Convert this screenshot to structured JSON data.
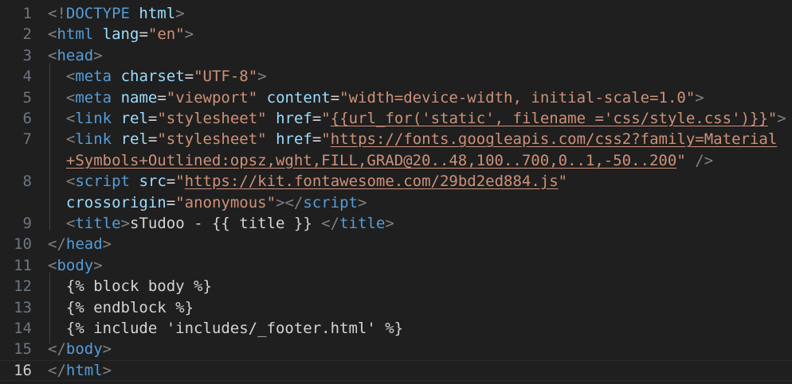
{
  "editor": {
    "language": "html",
    "active_line": 16,
    "lines": [
      {
        "num": "1",
        "tokens": [
          [
            "p",
            "<!"
          ],
          [
            "t",
            "DOCTYPE"
          ],
          [
            "d",
            " "
          ],
          [
            "a",
            "html"
          ],
          [
            "p",
            ">"
          ]
        ]
      },
      {
        "num": "2",
        "tokens": [
          [
            "p",
            "<"
          ],
          [
            "t",
            "html"
          ],
          [
            "d",
            " "
          ],
          [
            "a",
            "lang"
          ],
          [
            "d",
            "="
          ],
          [
            "s",
            "\"en\""
          ],
          [
            "p",
            ">"
          ]
        ]
      },
      {
        "num": "3",
        "tokens": [
          [
            "p",
            "<"
          ],
          [
            "t",
            "head"
          ],
          [
            "p",
            ">"
          ]
        ]
      },
      {
        "num": "4",
        "tokens": [
          [
            "d",
            "  "
          ],
          [
            "p",
            "<"
          ],
          [
            "t",
            "meta"
          ],
          [
            "d",
            " "
          ],
          [
            "a",
            "charset"
          ],
          [
            "d",
            "="
          ],
          [
            "s",
            "\"UTF-8\""
          ],
          [
            "p",
            ">"
          ]
        ]
      },
      {
        "num": "5",
        "tokens": [
          [
            "d",
            "  "
          ],
          [
            "p",
            "<"
          ],
          [
            "t",
            "meta"
          ],
          [
            "d",
            " "
          ],
          [
            "a",
            "name"
          ],
          [
            "d",
            "="
          ],
          [
            "s",
            "\"viewport\""
          ],
          [
            "d",
            " "
          ],
          [
            "a",
            "content"
          ],
          [
            "d",
            "="
          ],
          [
            "s",
            "\"width=device-width, initial-scale=1.0\""
          ],
          [
            "p",
            ">"
          ]
        ]
      },
      {
        "num": "6",
        "tokens": [
          [
            "d",
            "  "
          ],
          [
            "p",
            "<"
          ],
          [
            "t",
            "link"
          ],
          [
            "d",
            " "
          ],
          [
            "a",
            "rel"
          ],
          [
            "d",
            "="
          ],
          [
            "s",
            "\"stylesheet\""
          ],
          [
            "d",
            " "
          ],
          [
            "a",
            "href"
          ],
          [
            "d",
            "="
          ],
          [
            "s",
            "\""
          ],
          [
            "u",
            "{{url_for('static', filename ='css/style.css')}}"
          ],
          [
            "s",
            "\""
          ],
          [
            "p",
            ">"
          ]
        ]
      },
      {
        "num": "7",
        "tokens": [
          [
            "d",
            "  "
          ],
          [
            "p",
            "<"
          ],
          [
            "t",
            "link"
          ],
          [
            "d",
            " "
          ],
          [
            "a",
            "rel"
          ],
          [
            "d",
            "="
          ],
          [
            "s",
            "\"stylesheet\""
          ],
          [
            "d",
            " "
          ],
          [
            "a",
            "href"
          ],
          [
            "d",
            "="
          ],
          [
            "s",
            "\""
          ],
          [
            "u",
            "https://fonts.googleapis.com/css2?family=Material"
          ]
        ]
      },
      {
        "num": "",
        "tokens": [
          [
            "d",
            "  "
          ],
          [
            "u",
            "+Symbols+Outlined:opsz,wght,FILL,GRAD@20..48,100..700,0..1,-50..200"
          ],
          [
            "s",
            "\""
          ],
          [
            "d",
            " "
          ],
          [
            "p",
            "/>"
          ]
        ]
      },
      {
        "num": "8",
        "tokens": [
          [
            "d",
            "  "
          ],
          [
            "p",
            "<"
          ],
          [
            "t",
            "script"
          ],
          [
            "d",
            " "
          ],
          [
            "a",
            "src"
          ],
          [
            "d",
            "="
          ],
          [
            "s",
            "\""
          ],
          [
            "u",
            "https://kit.fontawesome.com/29bd2ed884.js"
          ],
          [
            "s",
            "\""
          ]
        ]
      },
      {
        "num": "",
        "tokens": [
          [
            "d",
            "  "
          ],
          [
            "a",
            "crossorigin"
          ],
          [
            "d",
            "="
          ],
          [
            "s",
            "\"anonymous\""
          ],
          [
            "p",
            "></"
          ],
          [
            "t",
            "script"
          ],
          [
            "p",
            ">"
          ]
        ]
      },
      {
        "num": "9",
        "tokens": [
          [
            "d",
            "  "
          ],
          [
            "p",
            "<"
          ],
          [
            "t",
            "title"
          ],
          [
            "p",
            ">"
          ],
          [
            "d",
            "sTudoo - {{ title }} "
          ],
          [
            "p",
            "</"
          ],
          [
            "t",
            "title"
          ],
          [
            "p",
            ">"
          ]
        ]
      },
      {
        "num": "10",
        "tokens": [
          [
            "p",
            "</"
          ],
          [
            "t",
            "head"
          ],
          [
            "p",
            ">"
          ]
        ]
      },
      {
        "num": "11",
        "tokens": [
          [
            "p",
            "<"
          ],
          [
            "t",
            "body"
          ],
          [
            "p",
            ">"
          ]
        ]
      },
      {
        "num": "12",
        "tokens": [
          [
            "d",
            "  {% block body %}"
          ]
        ]
      },
      {
        "num": "13",
        "tokens": [
          [
            "d",
            "  {% endblock %}"
          ]
        ]
      },
      {
        "num": "14",
        "tokens": [
          [
            "d",
            "  {% include 'includes/_footer.html' %}"
          ]
        ]
      },
      {
        "num": "15",
        "tokens": [
          [
            "p",
            "</"
          ],
          [
            "t",
            "body"
          ],
          [
            "p",
            ">"
          ]
        ]
      },
      {
        "num": "16",
        "tokens": [
          [
            "p",
            "</"
          ],
          [
            "t",
            "html"
          ],
          [
            "p",
            ">"
          ]
        ]
      }
    ]
  }
}
